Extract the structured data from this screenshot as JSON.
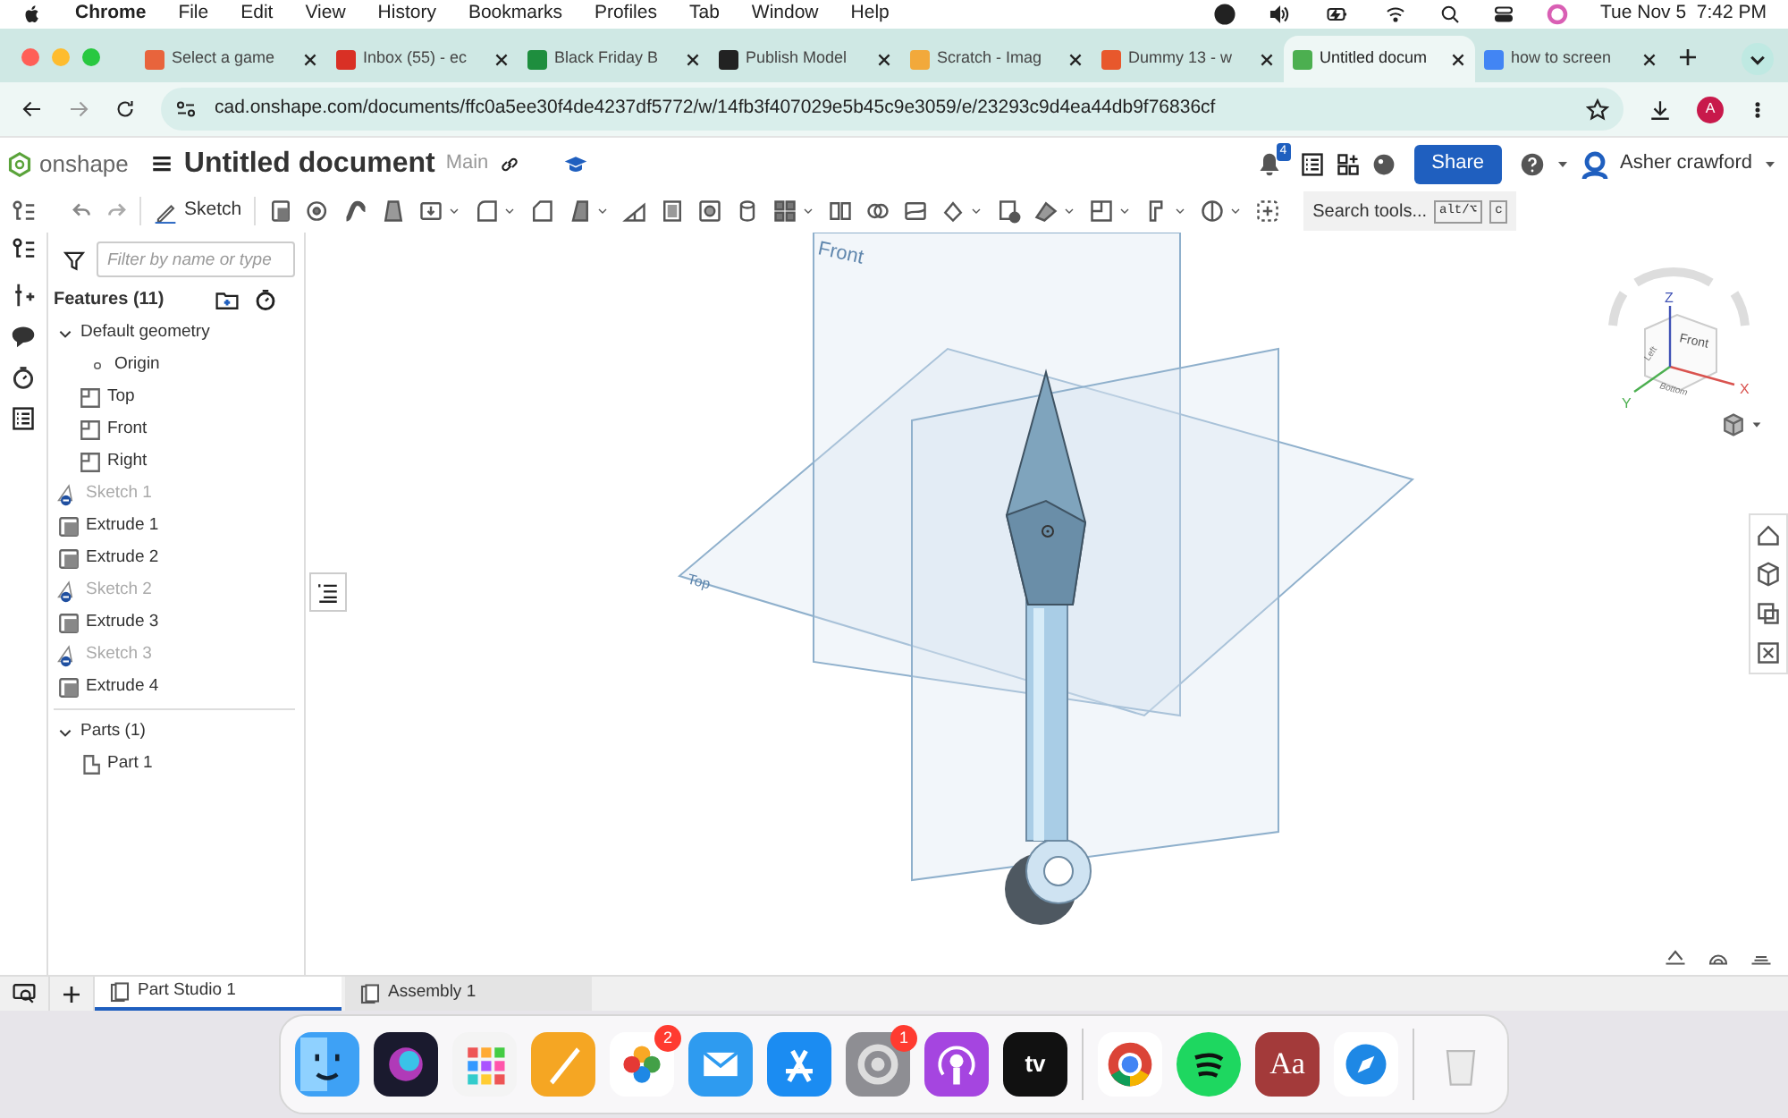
{
  "menu_bar": {
    "app": "Chrome",
    "items": [
      "File",
      "Edit",
      "View",
      "History",
      "Bookmarks",
      "Profiles",
      "Tab",
      "Window",
      "Help"
    ],
    "clock": "Tue Nov 5  7:42 PM"
  },
  "browser_tabs": [
    {
      "title": "Select a game",
      "selected": false,
      "color": "#e8643c"
    },
    {
      "title": "Inbox (55) - ec",
      "selected": false,
      "color": "#d93025"
    },
    {
      "title": "Black Friday B",
      "selected": false,
      "color": "#1e8e3e"
    },
    {
      "title": "Publish Model",
      "selected": false,
      "color": "#222222"
    },
    {
      "title": "Scratch - Imag",
      "selected": false,
      "color": "#f2a93b"
    },
    {
      "title": "Dummy 13 - w",
      "selected": false,
      "color": "#e8582c"
    },
    {
      "title": "Untitled docum",
      "selected": true,
      "color": "#4caf50"
    },
    {
      "title": "how to screen",
      "selected": false,
      "color": "#4285f4"
    }
  ],
  "address_bar": {
    "url": "cad.onshape.com/documents/ffc0a5ee30f4de4237df5772/w/14fb3f407029e5b45c9e3059/e/23293c9d4ea44db9f76836cf",
    "avatar": "A"
  },
  "app_header": {
    "logo": "onshape",
    "title": "Untitled document",
    "branch": "Main",
    "notifications": "4",
    "share": "Share",
    "user": "Asher crawford"
  },
  "toolbar": {
    "sketch": "Sketch",
    "search": "Search tools...",
    "shortcut": [
      "alt/⌥",
      "c"
    ]
  },
  "features": {
    "filter_placeholder": "Filter by name or type",
    "heading": "Features (11)",
    "tree": [
      {
        "label": "Default geometry",
        "kind": "group",
        "expanded": true,
        "children": [
          {
            "label": "Origin",
            "kind": "point"
          },
          {
            "label": "Top",
            "kind": "plane"
          },
          {
            "label": "Front",
            "kind": "plane"
          },
          {
            "label": "Right",
            "kind": "plane"
          }
        ]
      },
      {
        "label": "Sketch 1",
        "kind": "sketch",
        "hidden": true
      },
      {
        "label": "Extrude 1",
        "kind": "extrude",
        "hidden": false
      },
      {
        "label": "Extrude 2",
        "kind": "extrude",
        "hidden": false
      },
      {
        "label": "Sketch 2",
        "kind": "sketch",
        "hidden": true
      },
      {
        "label": "Extrude 3",
        "kind": "extrude",
        "hidden": false
      },
      {
        "label": "Sketch 3",
        "kind": "sketch",
        "hidden": true
      },
      {
        "label": "Extrude 4",
        "kind": "extrude",
        "hidden": false
      }
    ],
    "parts": {
      "label": "Parts (1)",
      "expanded": true,
      "children": [
        {
          "label": "Part 1",
          "kind": "part"
        }
      ]
    }
  },
  "viewport": {
    "planes": [
      "Front",
      "Top"
    ],
    "view_cube": {
      "faces": [
        "Front",
        "Left",
        "Bottom"
      ],
      "axes": [
        "X",
        "Y",
        "Z"
      ]
    }
  },
  "bottom_tabs": [
    {
      "label": "Part Studio 1",
      "selected": true
    },
    {
      "label": "Assembly 1",
      "selected": false
    }
  ],
  "dock": [
    {
      "kind": "finder"
    },
    {
      "kind": "siri"
    },
    {
      "kind": "launchpad"
    },
    {
      "kind": "pages"
    },
    {
      "kind": "photos",
      "badge": "2"
    },
    {
      "kind": "mail"
    },
    {
      "kind": "appstore"
    },
    {
      "kind": "settings",
      "badge": "1"
    },
    {
      "kind": "podcasts"
    },
    {
      "kind": "tv",
      "label": "tv"
    },
    {
      "kind": "separator"
    },
    {
      "kind": "chrome"
    },
    {
      "kind": "spotify"
    },
    {
      "kind": "dictionary",
      "label": "Aa"
    },
    {
      "kind": "safari"
    },
    {
      "kind": "separator"
    },
    {
      "kind": "trash"
    }
  ]
}
